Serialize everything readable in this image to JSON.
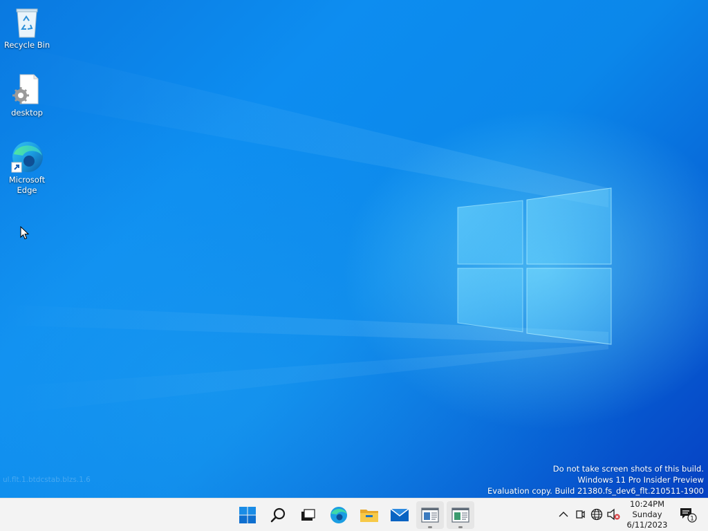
{
  "desktop": {
    "icons": [
      {
        "label": "Recycle Bin",
        "icon": "recycle-bin-icon"
      },
      {
        "label": "desktop",
        "icon": "settings-file-icon"
      },
      {
        "label": "Microsoft Edge",
        "icon": "edge-shortcut-icon"
      }
    ],
    "watermark": {
      "line1": "Do not take screen shots of this build.",
      "line2": "Windows 11 Pro Insider Preview",
      "line3": "Evaluation copy. Build 21380.fs_dev6_flt.210511-1900"
    },
    "faint_text": "ul.flt.1.btdcstab.blzs.1.6"
  },
  "taskbar": {
    "apps": [
      {
        "name": "Start",
        "icon": "windows-start-icon"
      },
      {
        "name": "Search",
        "icon": "search-icon"
      },
      {
        "name": "Task View",
        "icon": "task-view-icon"
      },
      {
        "name": "Microsoft Edge",
        "icon": "edge-icon"
      },
      {
        "name": "File Explorer",
        "icon": "file-explorer-icon"
      },
      {
        "name": "Mail",
        "icon": "mail-icon"
      },
      {
        "name": "Window 1",
        "icon": "app-window-icon",
        "running": true
      },
      {
        "name": "Window 2",
        "icon": "app-window-icon",
        "running": true
      }
    ],
    "tray": {
      "icons": [
        "chevron-up-icon",
        "meet-now-icon",
        "network-globe-icon",
        "volume-muted-icon"
      ],
      "clock": {
        "time": "10:24PM",
        "day": "Sunday",
        "date": "6/11/2023"
      },
      "notifications": {
        "icon": "action-center-icon",
        "count": "1"
      }
    }
  },
  "colors": {
    "desktop_blue": "#0b87ea",
    "taskbar_bg": "#f3f3f3",
    "windows_blue": "#0078d4"
  }
}
